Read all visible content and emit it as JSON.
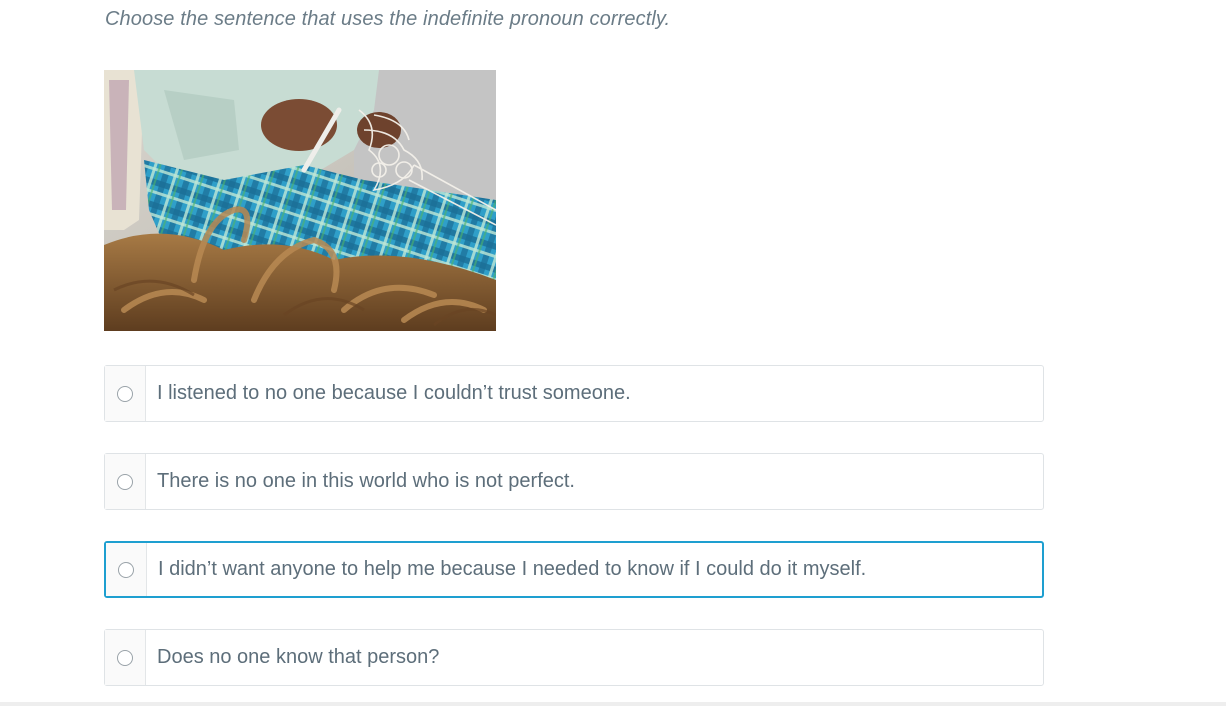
{
  "question": {
    "prompt": "Choose the sentence that uses the indefinite pronoun correctly."
  },
  "image": {
    "icon": "photo-person-weaving-net"
  },
  "options": [
    {
      "label": "I listened to no one because I couldn’t trust someone.",
      "selected": false
    },
    {
      "label": "There is no one in this world who is not perfect.",
      "selected": false
    },
    {
      "label": "I didn’t want anyone to help me because I needed to know if I could do it myself.",
      "selected": true
    },
    {
      "label": "Does no one know that person?",
      "selected": false
    }
  ],
  "colors": {
    "selected_border": "#1e9fd0",
    "option_border": "#dfe3e6",
    "text": "#5d6e7a"
  }
}
